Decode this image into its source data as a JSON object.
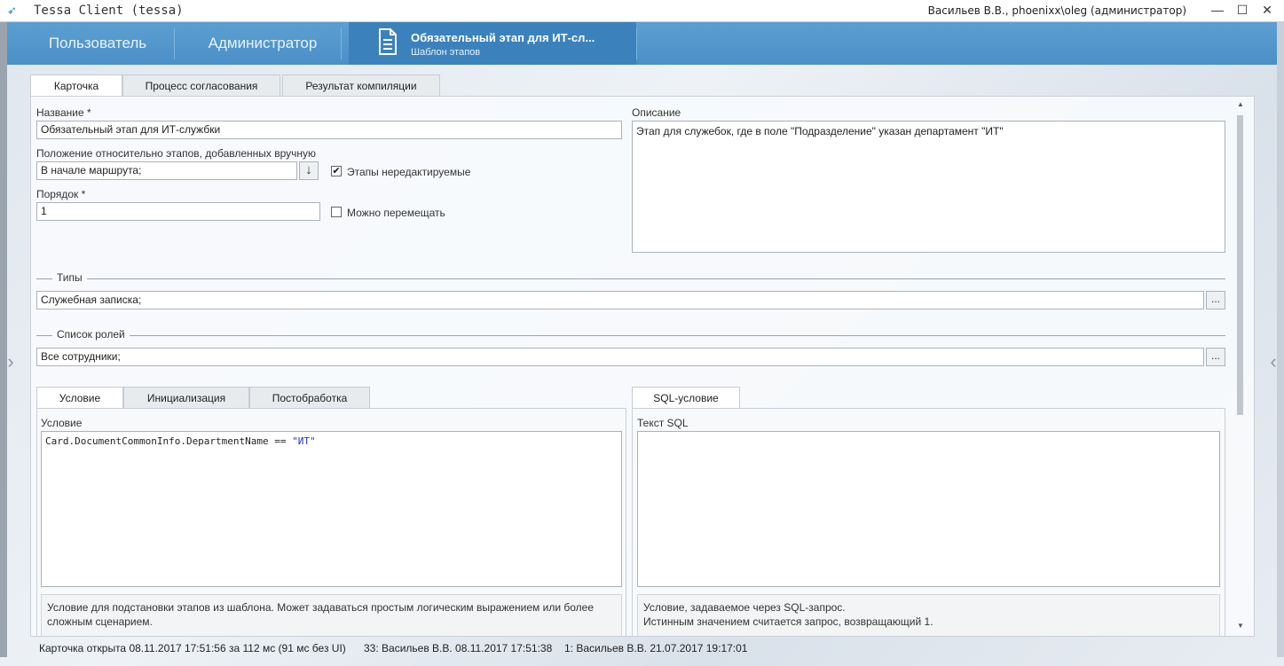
{
  "window": {
    "title": "Tessa Client (tessa)",
    "user_info": "Васильев В.В., phoenixx\\oleg (администратор)",
    "minimize": "—",
    "maximize": "☐",
    "close": "✕"
  },
  "nav": {
    "tabs": [
      "Пользователь",
      "Администратор"
    ],
    "active_card_title": "Обязательный этап для ИТ-сл...",
    "active_card_subtitle": "Шаблон этапов"
  },
  "card_tabs": [
    "Карточка",
    "Процесс согласования",
    "Результат компиляции"
  ],
  "form": {
    "name_label": "Название  *",
    "name_value": "Обязательный этап для ИТ-службки",
    "position_label": "Положение относительно этапов, добавленных вручную",
    "position_value": "В начале маршрута;",
    "position_dropdown_glyph": "↓",
    "locked_checkbox_label": "Этапы нередактируемые",
    "locked_checked": true,
    "order_label": "Порядок  *",
    "order_value": "1",
    "movable_checkbox_label": "Можно перемещать",
    "movable_checked": false,
    "description_label": "Описание",
    "description_value": "Этап для служебок, где в поле \"Подразделение\" указан департамент \"ИТ\"",
    "types_section": "Типы",
    "types_value": "Служебная записка;",
    "roles_section": "Список ролей",
    "roles_value": "Все сотрудники;",
    "ellipsis": "..."
  },
  "condition_tabs": [
    "Условие",
    "Инициализация",
    "Постобработка"
  ],
  "condition": {
    "label": "Условие",
    "code_prefix": "Card.DocumentCommonInfo.DepartmentName == ",
    "code_string": "\"ИТ\"",
    "hint_line1": "Условие для подстановки этапов из шаблона. Может задаваться простым логическим выражением или более",
    "hint_line2": "сложным сценарием."
  },
  "sql_tabs": [
    "SQL-условие"
  ],
  "sql": {
    "label": "Текст SQL",
    "hint_line1": "Условие, задаваемое через SQL-запрос.",
    "hint_line2": "Истинным значением считается запрос, возвращающий 1."
  },
  "status": {
    "opened": "Карточка открыта 08.11.2017 17:51:56 за 112 мс (91 мс без UI)",
    "version": "33:  Васильев В.В.  08.11.2017 17:51:38",
    "created": "1:  Васильев В.В.  21.07.2017 19:17:01"
  },
  "colors": {
    "nav_bg": "#4a8fc7",
    "nav_active": "#3b82bd",
    "accent": "#2a87c8"
  }
}
